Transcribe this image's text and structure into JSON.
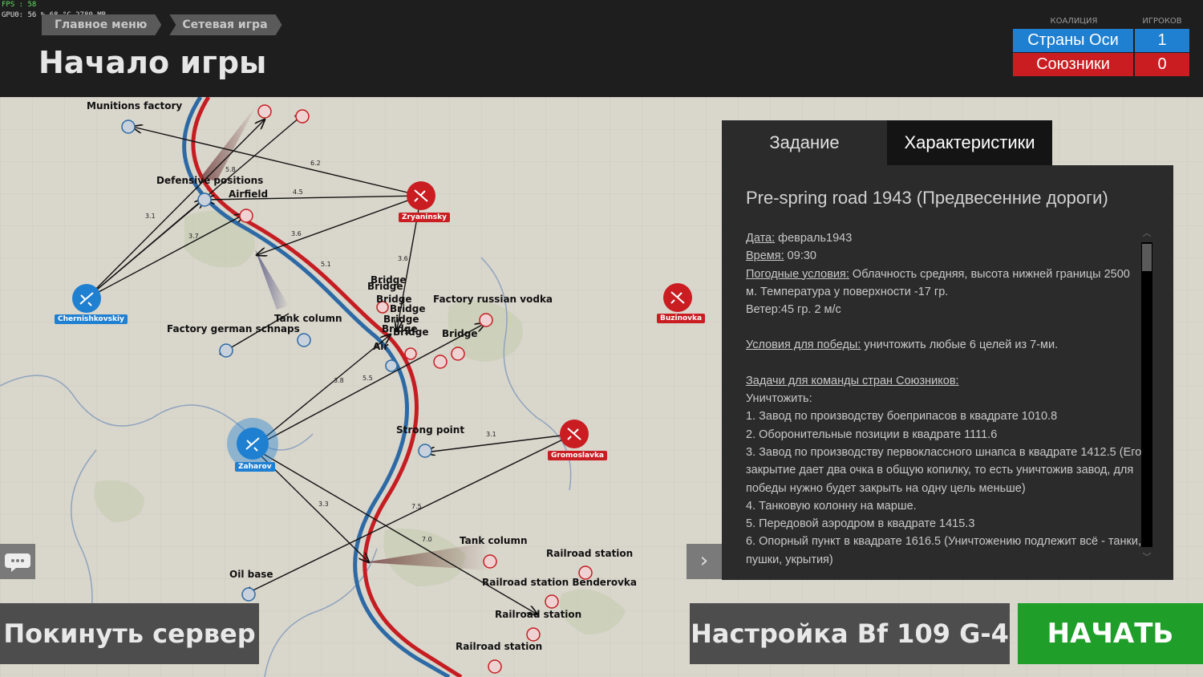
{
  "hud": {
    "fps_line": "FPS :  58",
    "gpu_line": "GPU0:  56 %  68 °C 2780 MB"
  },
  "breadcrumb": [
    {
      "label": "Главное меню"
    },
    {
      "label": "Сетевая игра"
    }
  ],
  "page_title": "Начало игры",
  "coalition": {
    "header_coalition": "КОАЛИЦИЯ",
    "header_players": "ИГРОКОВ",
    "rows": [
      {
        "name": "Страны Оси",
        "players": "1",
        "color": "#1f7fd1"
      },
      {
        "name": "Союзники",
        "players": "0",
        "color": "#c91d22"
      }
    ]
  },
  "tabs": [
    {
      "label": "Задание"
    },
    {
      "label": "Характеристики"
    }
  ],
  "briefing": {
    "title": "Pre-spring road 1943 (Предвесенние дороги)",
    "date_label": "Дата:",
    "date_value": " февраль1943",
    "time_label": "Время:",
    "time_value": " 09:30",
    "weather_label": "Погодные условия:",
    "weather_value": " Облачность средняя, высота нижней границы 2500 м. Температура у поверхности -17 гр.",
    "wind": " Ветер:45 гр. 2 м/с",
    "victory_label": "Условия для победы:",
    "victory_value": " уничтожить любые 6 целей из 7-ми.",
    "tasks_label": "Задачи для команды стран Союзников:",
    "destroy": "Уничтожить:",
    "tasks": [
      "1. Завод по производству боеприпасов в квадрате 1010.8",
      "2. Оборонительные позиции в квадрате 1111.6",
      "3. Завод по производству первоклассного шнапса в квадрате 1412.5 (Его закрытие дает два очка в общую копилку, то есть уничтожив завод, для победы нужно будет закрыть на одну цель меньше)",
      "4. Танковую колонну на марше.",
      "5. Передовой аэродром в квадрате 1415.3",
      "6. Опорный пункт в квадрате 1616.5 (Уничтожению подлежит всё - танки, пушки, укрытия)"
    ]
  },
  "buttons": {
    "leave": "Покинуть сервер",
    "setup": "Настройка Bf 109 G-4",
    "start": "НАЧАТЬ"
  },
  "map": {
    "bases": [
      {
        "name": "Chernishkovskiy",
        "side": "axis"
      },
      {
        "name": "Zaharov",
        "side": "axis"
      },
      {
        "name": "Zryaninsky",
        "side": "allies"
      },
      {
        "name": "Buzinovka",
        "side": "allies"
      },
      {
        "name": "Gromoslavka",
        "side": "allies"
      }
    ],
    "labels": [
      "Munitions factory",
      "Defensive positions",
      "Airfield",
      "Tank column",
      "Factory german schnaps",
      "Bridge",
      "Bridge",
      "Bridge",
      "Bridge",
      "Bridge",
      "Bridge",
      "Bridge",
      "Bridge",
      "Factory russian vodka",
      "Air",
      "Strong point",
      "Tank column",
      "Railroad station",
      "Railroad station Benderovka",
      "Railroad station",
      "Railroad station",
      "Oil base"
    ],
    "distances": [
      "6.2",
      "5.8",
      "4.5",
      "3.1",
      "3.7",
      "3.6",
      "5.1",
      "3.6",
      "3.8",
      "5.5",
      "3.1",
      "3.3",
      "7.5",
      "7.0"
    ]
  }
}
